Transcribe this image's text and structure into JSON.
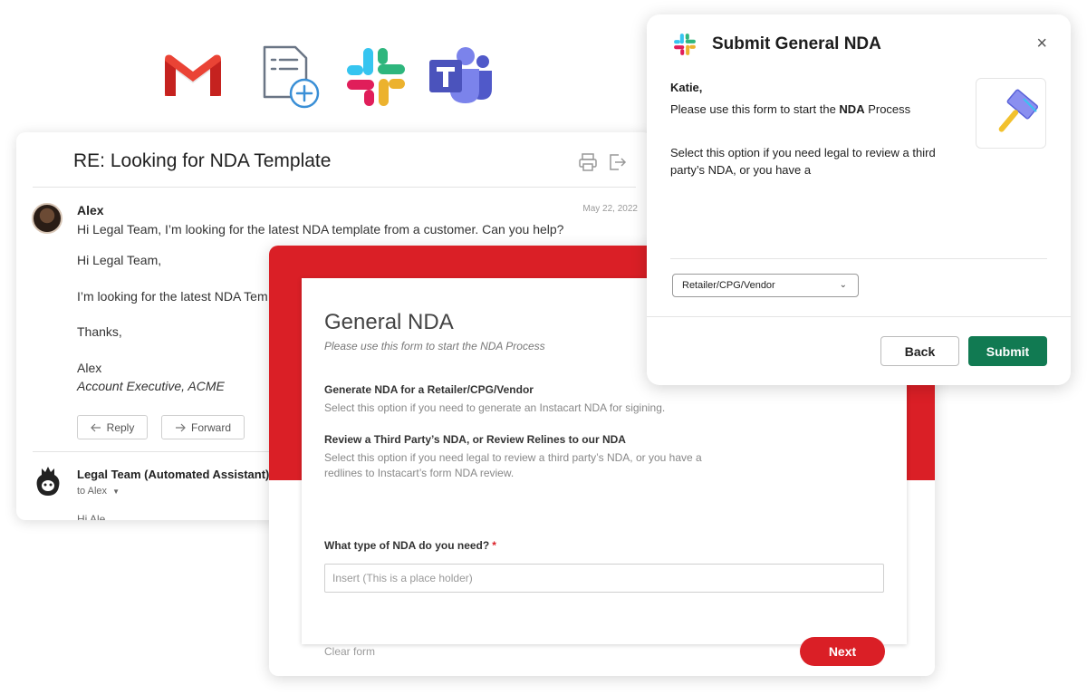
{
  "app_icons": [
    {
      "name": "gmail-icon"
    },
    {
      "name": "form-add-icon"
    },
    {
      "name": "slack-icon"
    },
    {
      "name": "teams-icon"
    }
  ],
  "email": {
    "subject": "RE: Looking for NDA Template",
    "message": {
      "sender": "Alex",
      "date": "May 22, 2022",
      "preview": "Hi Legal Team, I’m looking for the latest NDA template from a customer. Can you help?",
      "body_greeting": "Hi Legal Team,",
      "body_line": "I’m looking for the latest NDA Tem",
      "body_thanks": "Thanks,",
      "signature_name": "Alex",
      "signature_role": "Account Executive, ACME"
    },
    "reply_label": "Reply",
    "forward_label": "Forward",
    "reply": {
      "sender": "Legal Team (Automated Assistant)",
      "to": "to Alex",
      "preview": "Hi Ale"
    }
  },
  "form": {
    "title": "General NDA",
    "subtitle": "Please use this form to start the NDA Process",
    "options": [
      {
        "heading": "Generate NDA for a Retailer/CPG/Vendor",
        "desc": "Select this option if you need to generate an Instacart NDA for sigining."
      },
      {
        "heading": "Review a Third Party’s NDA, or Review Relines to our NDA",
        "desc": "Select this option if you need legal to review a third party’s NDA, or you have a redlines to Instacart’s form NDA review."
      }
    ],
    "question": "What type of NDA do you need?",
    "required_mark": "*",
    "input_placeholder": "Insert (This is a place holder)",
    "clear_label": "Clear form",
    "next_label": "Next"
  },
  "modal": {
    "title": "Submit General NDA",
    "close_glyph": "×",
    "greeting": "Katie,",
    "intro_prefix": "Please use this form to start the ",
    "intro_bold": "NDA",
    "intro_suffix": " Process",
    "select_text": "Select this option if you need legal to review a third party’s NDA, or you have a",
    "dropdown_value": "Retailer/CPG/Vendor",
    "back_label": "Back",
    "submit_label": "Submit"
  },
  "colors": {
    "form_red": "#da1f26",
    "submit_green": "#117a52"
  }
}
